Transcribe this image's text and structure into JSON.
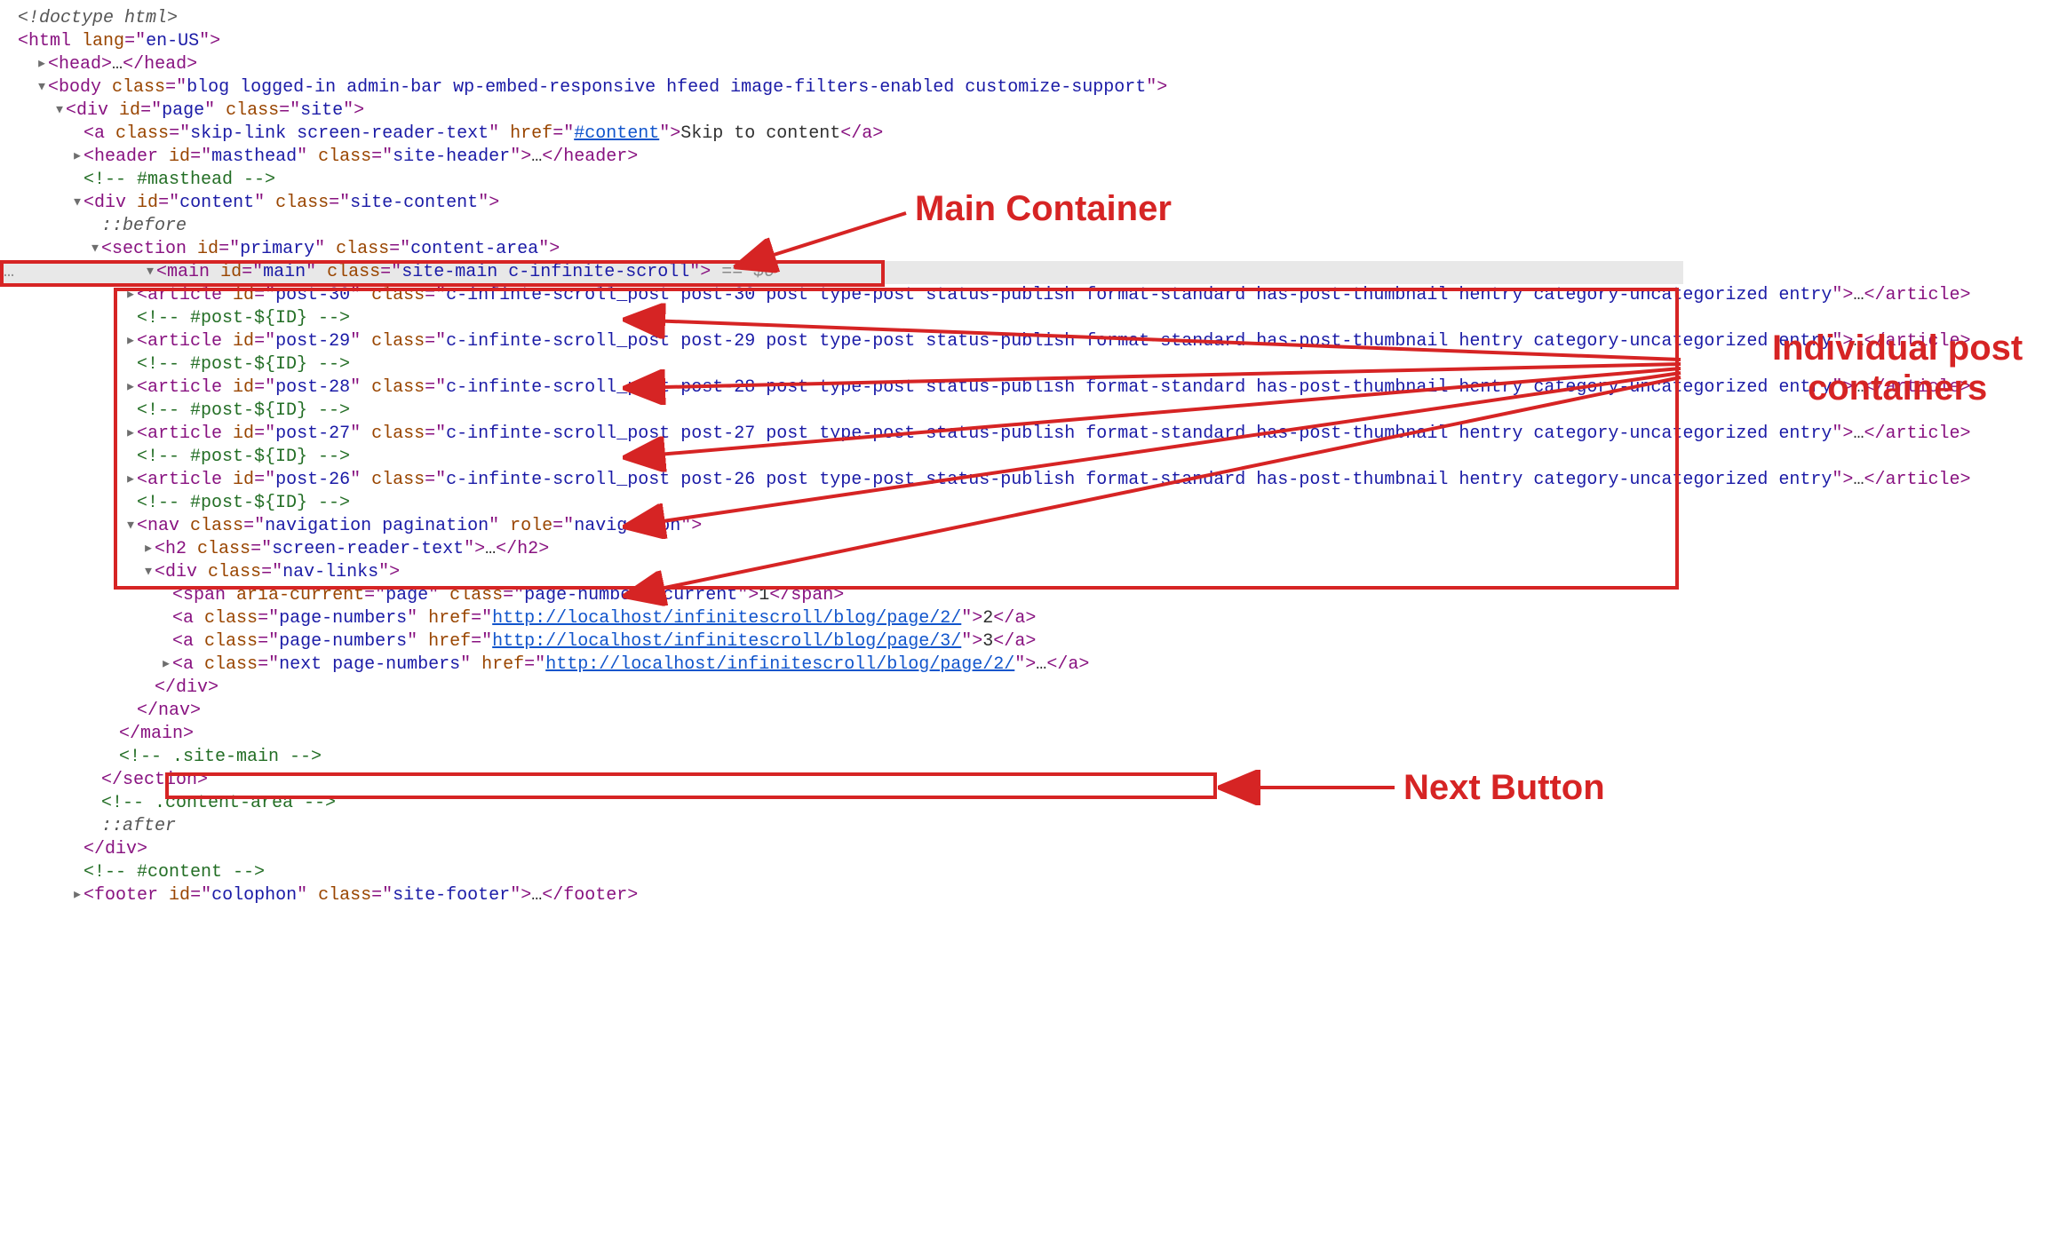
{
  "annotation_labels": {
    "main_container": "Main Container",
    "post_containers": "Individual post\ncontainers",
    "next_button": "Next Button"
  },
  "doctype": "<!doctype html>",
  "html_lang": "en-US",
  "head": {
    "ellipsis": "…"
  },
  "body_class": "blog logged-in admin-bar wp-embed-responsive hfeed image-filters-enabled customize-support",
  "page_div": {
    "id": "page",
    "class": "site"
  },
  "skip_link": {
    "class": "skip-link screen-reader-text",
    "href": "#content",
    "text": "Skip to content"
  },
  "header": {
    "id": "masthead",
    "class": "site-header",
    "ellipsis": "…"
  },
  "comment_masthead": "<!-- #masthead -->",
  "content_div": {
    "id": "content",
    "class": "site-content"
  },
  "pseudo_before": "::before",
  "section": {
    "id": "primary",
    "class": "content-area"
  },
  "main": {
    "id": "main",
    "class": "site-main c-infinite-scroll",
    "eq": " == $0",
    "dots_prefix": "…"
  },
  "posts": [
    {
      "id": "post-30",
      "class": "c-infinte-scroll_post post-30 post type-post status-publish format-standard has-post-thumbnail hentry category-uncategorized entry",
      "ellipsis": "…"
    },
    {
      "id": "post-29",
      "class": "c-infinte-scroll_post post-29 post type-post status-publish format-standard has-post-thumbnail hentry category-uncategorized entry",
      "ellipsis": "…"
    },
    {
      "id": "post-28",
      "class": "c-infinte-scroll_post post-28 post type-post status-publish format-standard has-post-thumbnail hentry category-uncategorized entry",
      "ellipsis": "…"
    },
    {
      "id": "post-27",
      "class": "c-infinte-scroll_post post-27 post type-post status-publish format-standard has-post-thumbnail hentry category-uncategorized entry",
      "ellipsis": "…"
    },
    {
      "id": "post-26",
      "class": "c-infinte-scroll_post post-26 post type-post status-publish format-standard has-post-thumbnail hentry category-uncategorized entry",
      "ellipsis": "…"
    }
  ],
  "post_comment": "<!-- #post-${ID} -->",
  "nav": {
    "class": "navigation pagination",
    "role": "navigation"
  },
  "h2": {
    "class": "screen-reader-text",
    "ellipsis": "…"
  },
  "navlinks_div": {
    "class": "nav-links"
  },
  "page_current": {
    "aria_current": "page",
    "class": "page-numbers current",
    "text": "1"
  },
  "page2": {
    "class": "page-numbers",
    "href": "http://localhost/infinitescroll/blog/page/2/",
    "text": "2"
  },
  "page3": {
    "class": "page-numbers",
    "href": "http://localhost/infinitescroll/blog/page/3/",
    "text": "3"
  },
  "next_link": {
    "class": "next page-numbers",
    "href": "http://localhost/infinitescroll/blog/page/2/",
    "ellipsis": "…"
  },
  "comment_sitemain": "<!-- .site-main -->",
  "comment_contentarea": "<!-- .content-area -->",
  "pseudo_after": "::after",
  "comment_content": "<!-- #content -->",
  "footer": {
    "id": "colophon",
    "class": "site-footer",
    "ellipsis": "…"
  }
}
